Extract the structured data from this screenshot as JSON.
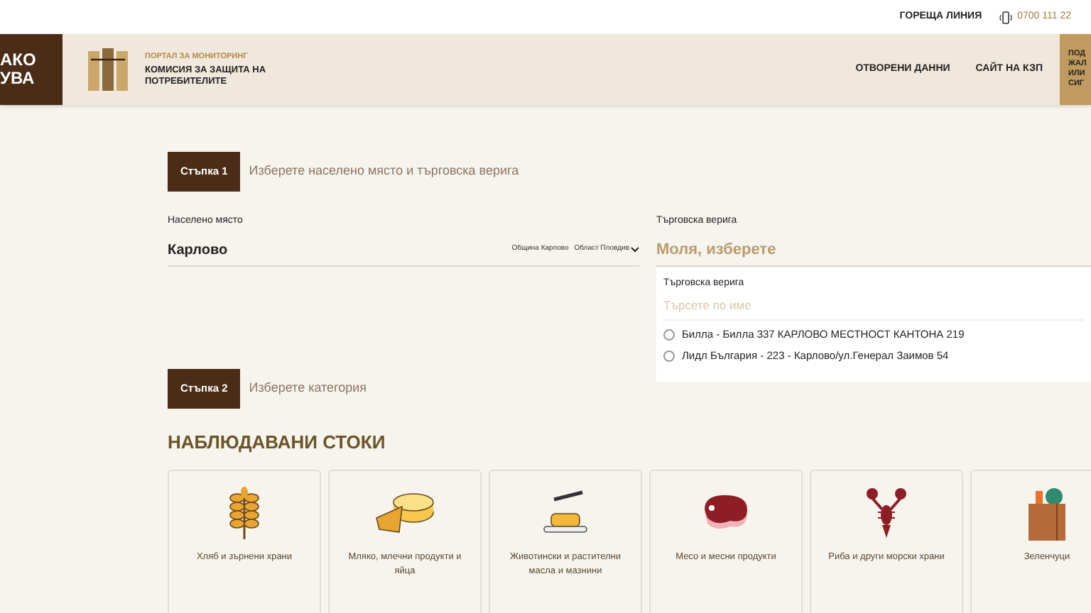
{
  "topbar": {
    "hotline_label": "ГОРЕЩА ЛИНИЯ",
    "phone": "0700 111 22"
  },
  "header": {
    "logo_lines": [
      "АКО",
      "УВА"
    ],
    "portal_label": "ПОРТАЛ ЗА МОНИТОРИНГ",
    "org_name": "КОМИСИЯ ЗА ЗАЩИТА НА ПОТРЕБИТЕЛИТЕ",
    "nav": [
      "ОТВОРЕНИ ДАННИ",
      "САЙТ НА КЗП"
    ],
    "cta_lines": [
      "ПОД",
      "ЖАЛ",
      "ИЛИ",
      "СИГ"
    ]
  },
  "step1": {
    "badge": "Стъпка 1",
    "title": "Изберете населено място и търговска верига",
    "place": {
      "label": "Населено място",
      "value": "Карлово",
      "municipality": "Община Карлово",
      "region": "Област Пловдив"
    },
    "chain": {
      "label": "Търговска верига",
      "placeholder": "Моля, изберете",
      "dropdown": {
        "label": "Търговска верига",
        "search_placeholder": "Търсете по име",
        "options": [
          {
            "label": "Билла - Билла 337 КАРЛОВО МЕСТНОСТ КАНТОНА 219",
            "selected": false
          },
          {
            "label": "Лидл България - 223 - Карлово/ул.Генерал Заимов 54",
            "selected": false
          }
        ]
      }
    }
  },
  "step2": {
    "badge": "Стъпка 2",
    "title": "Изберете категория",
    "heading": "НАБЛЮДАВАНИ СТОКИ",
    "categories": [
      {
        "kind": "grain",
        "label": "Хляб и зърнени храни"
      },
      {
        "kind": "cheese",
        "label": "Мляко, млечни продукти и яйца"
      },
      {
        "kind": "butter",
        "label": "Животински и растителни масла и мазнини"
      },
      {
        "kind": "meat",
        "label": "Месо и месни продукти"
      },
      {
        "kind": "lobster",
        "label": "Риба и други морски храни"
      },
      {
        "kind": "vegetables",
        "label": "Зеленчуци"
      }
    ]
  }
}
